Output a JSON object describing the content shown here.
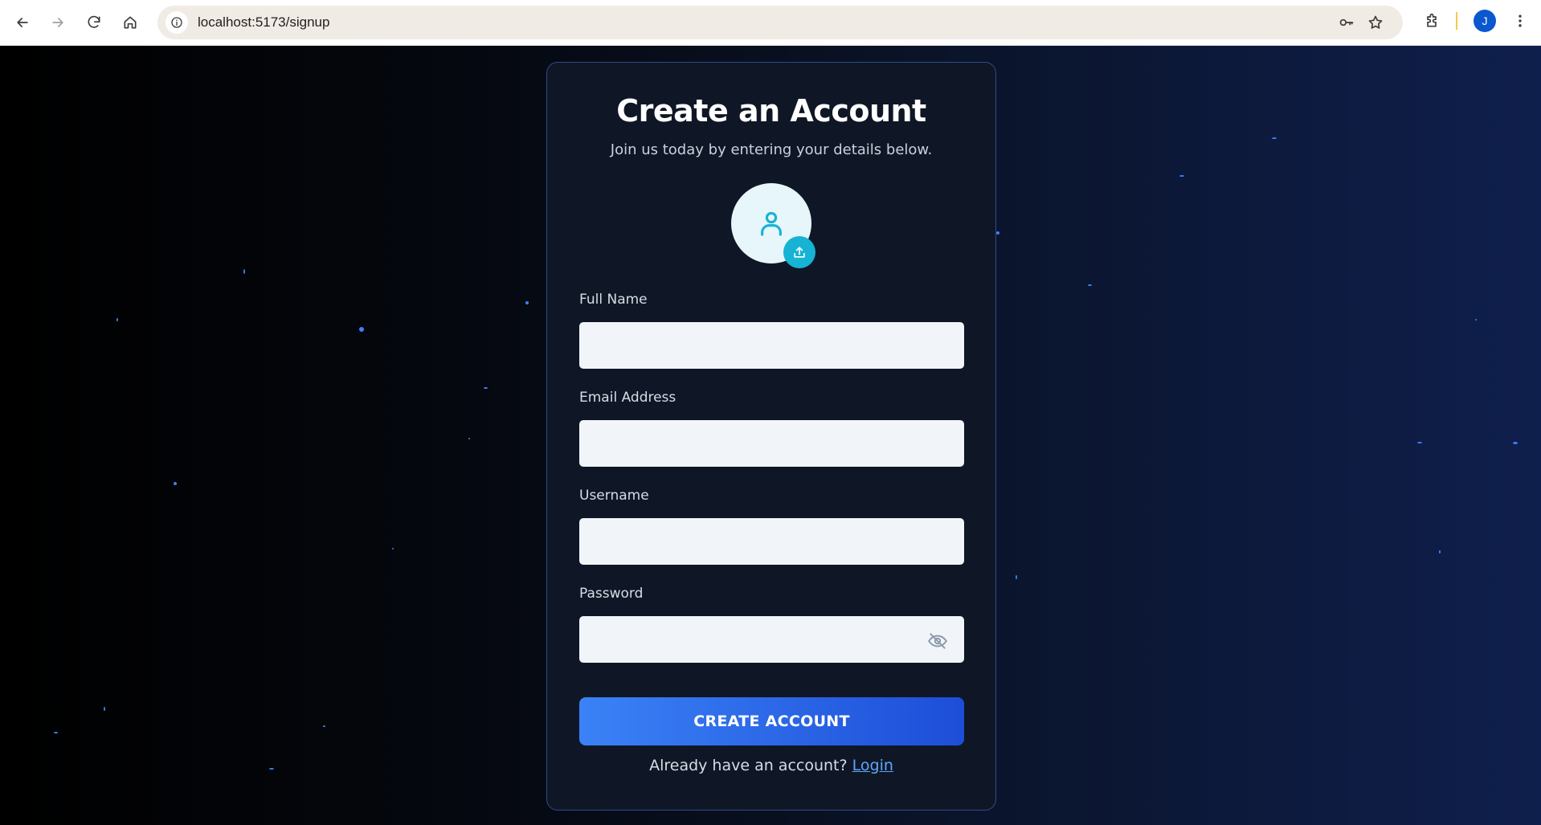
{
  "browser": {
    "url": "localhost:5173/signup",
    "profile_initial": "J",
    "icons": [
      "back-icon",
      "forward-icon",
      "reload-icon",
      "home-icon",
      "site-info-icon",
      "key-icon",
      "star-icon",
      "extensions-icon",
      "more-icon"
    ]
  },
  "signup": {
    "title": "Create an Account",
    "subtitle": "Join us today by entering your details below.",
    "fields": {
      "full_name": {
        "label": "Full Name",
        "value": ""
      },
      "email": {
        "label": "Email Address",
        "value": ""
      },
      "username": {
        "label": "Username",
        "value": ""
      },
      "password": {
        "label": "Password",
        "value": ""
      }
    },
    "submit_label": "CREATE ACCOUNT",
    "login_prompt": "Already have an account?",
    "login_link": "Login"
  },
  "colors": {
    "accent": "#17b3d4",
    "button_start": "#3b82f6",
    "button_end": "#1d4ed8",
    "card_bg": "#0f1726",
    "link": "#60a5fa"
  }
}
